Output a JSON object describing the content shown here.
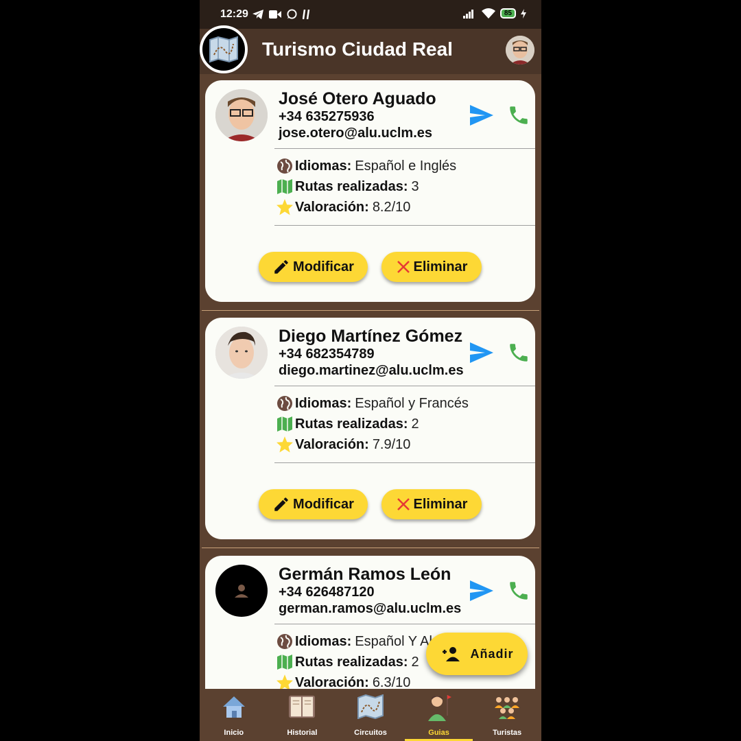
{
  "status_bar": {
    "time": "12:29",
    "battery": "85"
  },
  "app_bar": {
    "title": "Turismo Ciudad Real"
  },
  "guides": [
    {
      "name": "José Otero Aguado",
      "phone": "+34 635275936",
      "email": "jose.otero@alu.uclm.es",
      "languages_label": "Idiomas:",
      "languages": "Español e Inglés",
      "routes_label": "Rutas realizadas:",
      "routes": "3",
      "rating_label": "Valoración:",
      "rating": "8.2/10",
      "modify_label": "Modificar",
      "delete_label": "Eliminar"
    },
    {
      "name": "Diego Martínez Gómez",
      "phone": "+34 682354789",
      "email": "diego.martinez@alu.uclm.es",
      "languages_label": "Idiomas:",
      "languages": "Español y Francés",
      "routes_label": "Rutas realizadas:",
      "routes": "2",
      "rating_label": "Valoración:",
      "rating": "7.9/10",
      "modify_label": "Modificar",
      "delete_label": "Eliminar"
    },
    {
      "name": "Germán Ramos León",
      "phone": "+34 626487120",
      "email": "german.ramos@alu.uclm.es",
      "languages_label": "Idiomas:",
      "languages": "Español Y Al",
      "routes_label": "Rutas realizadas:",
      "routes": "2",
      "rating_label": "Valoración:",
      "rating": "6.3/10"
    }
  ],
  "fab": {
    "label": "Añadir",
    "icon": "person-add-icon"
  },
  "bottom_nav": {
    "items": [
      {
        "label": "Inicio",
        "icon": "house-icon"
      },
      {
        "label": "Historial",
        "icon": "book-icon"
      },
      {
        "label": "Circuitos",
        "icon": "map-icon"
      },
      {
        "label": "Guias",
        "icon": "guide-icon",
        "active": true
      },
      {
        "label": "Turistas",
        "icon": "tourists-icon"
      }
    ]
  },
  "colors": {
    "background": "#5b4130",
    "appbar": "#4a3528",
    "card": "#fbfcf7",
    "button": "#fdd835",
    "send": "#2196f3",
    "call": "#4caf50",
    "delete_x": "#e53935",
    "active_nav": "#fdd835"
  }
}
